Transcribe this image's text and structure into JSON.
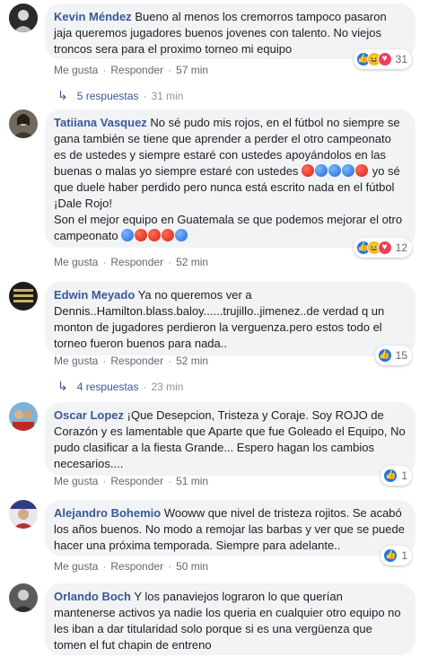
{
  "comments": [
    {
      "author": "Kevin Méndez",
      "text": "Bueno al menos los cremorros tampoco pasaron jaja queremos jugadores buenos jovenes con talento. No viejos troncos sera para el proximo torneo mi equipo",
      "like": "Me gusta",
      "reply": "Responder",
      "time": "57 min",
      "reaction_count": "31",
      "reactions": [
        "like-icon",
        "haha-icon",
        "love-icon"
      ],
      "replies_label": "5 respuestas",
      "replies_time": "31 min"
    },
    {
      "author": "Tatiiana Vasquez",
      "text_part1": "No sé pudo mis rojos, en el fútbol no siempre se gana también se tiene que aprender a perder el otro campeonato es de ustedes y siempre estaré con ustedes apoyándolos en las buenas o malas yo siempre estaré con ustedes",
      "text_part2": "yo sé que duele haber perdido pero nunca está escrito nada en el fútbol",
      "text_part3": "¡Dale Rojo!",
      "text_part4": "Son el mejor equipo en Guatemala se que podemos mejorar el otro campeonato",
      "emoji_row1": [
        "red",
        "blue",
        "blue",
        "blue",
        "red"
      ],
      "emoji_row2": [
        "blue",
        "red",
        "red",
        "red",
        "blue"
      ],
      "like": "Me gusta",
      "reply": "Responder",
      "time": "52 min",
      "reaction_count": "12",
      "reactions": [
        "like-icon",
        "haha-icon",
        "love-icon"
      ]
    },
    {
      "author": "Edwin Meyado",
      "text": "Ya no queremos ver a Dennis..Hamilton.blass.baloy......trujillo..jimenez..de verdad q un monton de jugadores perdieron la verguenza.pero estos todo el torneo fueron buenos para nada..",
      "like": "Me gusta",
      "reply": "Responder",
      "time": "52 min",
      "reaction_count": "15",
      "reactions": [
        "like-icon"
      ],
      "replies_label": "4 respuestas",
      "replies_time": "23 min"
    },
    {
      "author": "Oscar Lopez",
      "text": "¡Que Desepcion, Tristeza y Coraje. Soy ROJO de Corazón y es lamentable que Aparte que fue Goleado el Equipo, No pudo clasificar a la fiesta Grande... Espero hagan los cambios necesarios....",
      "like": "Me gusta",
      "reply": "Responder",
      "time": "51 min",
      "reaction_count": "1",
      "reactions": [
        "like-icon"
      ]
    },
    {
      "author": "Alejandro Bohemio",
      "text": "Wooww que nivel de tristeza rojitos. Se acabó los años buenos. No modo a remojar las barbas y ver que se puede hacer una próxima temporada. Siempre para adelante..",
      "like": "Me gusta",
      "reply": "Responder",
      "time": "50 min",
      "reaction_count": "1",
      "reactions": [
        "like-icon"
      ]
    },
    {
      "author": "Orlando Boch",
      "text": "Y los panaviejos lograron lo que querían mantenerse activos ya nadie los queria en cualquier otro equipo no les iban a dar titularidad solo porque si es una vergüenza que tomen el fut chapin de entreno"
    }
  ],
  "separator": "·",
  "reply_arrow": "↳",
  "colors": {
    "author": "#385898",
    "bubble": "#f2f3f5",
    "meta": "#616770",
    "like": "#1877f2",
    "love": "#f33e58",
    "haha": "#f7b928"
  }
}
